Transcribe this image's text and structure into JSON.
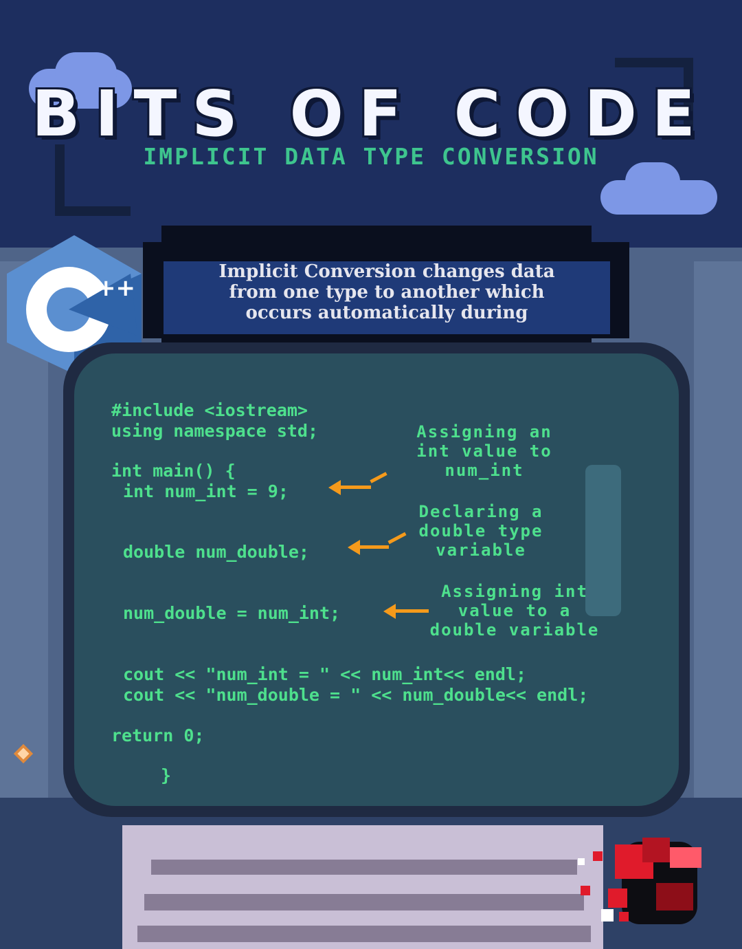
{
  "header": {
    "title": "BITS OF CODE",
    "subtitle": "IMPLICIT DATA TYPE CONVERSION"
  },
  "banner": {
    "lines": [
      "Implicit Conversion changes data",
      "from one type to another which",
      "occurs automatically during"
    ]
  },
  "code": {
    "lines": [
      "#include <iostream>",
      "using namespace std;",
      "int main() {",
      " int num_int = 9;",
      "double num_double;",
      "num_double = num_int;",
      "cout << \"num_int = \" << num_int<< endl;",
      "cout << \"num_double = \" << num_double<< endl;",
      "return 0;",
      "}"
    ]
  },
  "annotations": [
    {
      "lines": [
        "Assigning  an",
        "int  value  to",
        "num_int"
      ]
    },
    {
      "lines": [
        "Declaring a",
        "double type",
        "variable"
      ]
    },
    {
      "lines": [
        "Assigning int",
        "value to a",
        "double variable"
      ]
    }
  ],
  "logos": {
    "cpp": "C++",
    "cpp_plus": "++"
  },
  "colors": {
    "code_green": "#4ee08d",
    "arrow_orange": "#f59a1b",
    "sky": "#1d2e5f",
    "screen": "#2a4f5e"
  }
}
